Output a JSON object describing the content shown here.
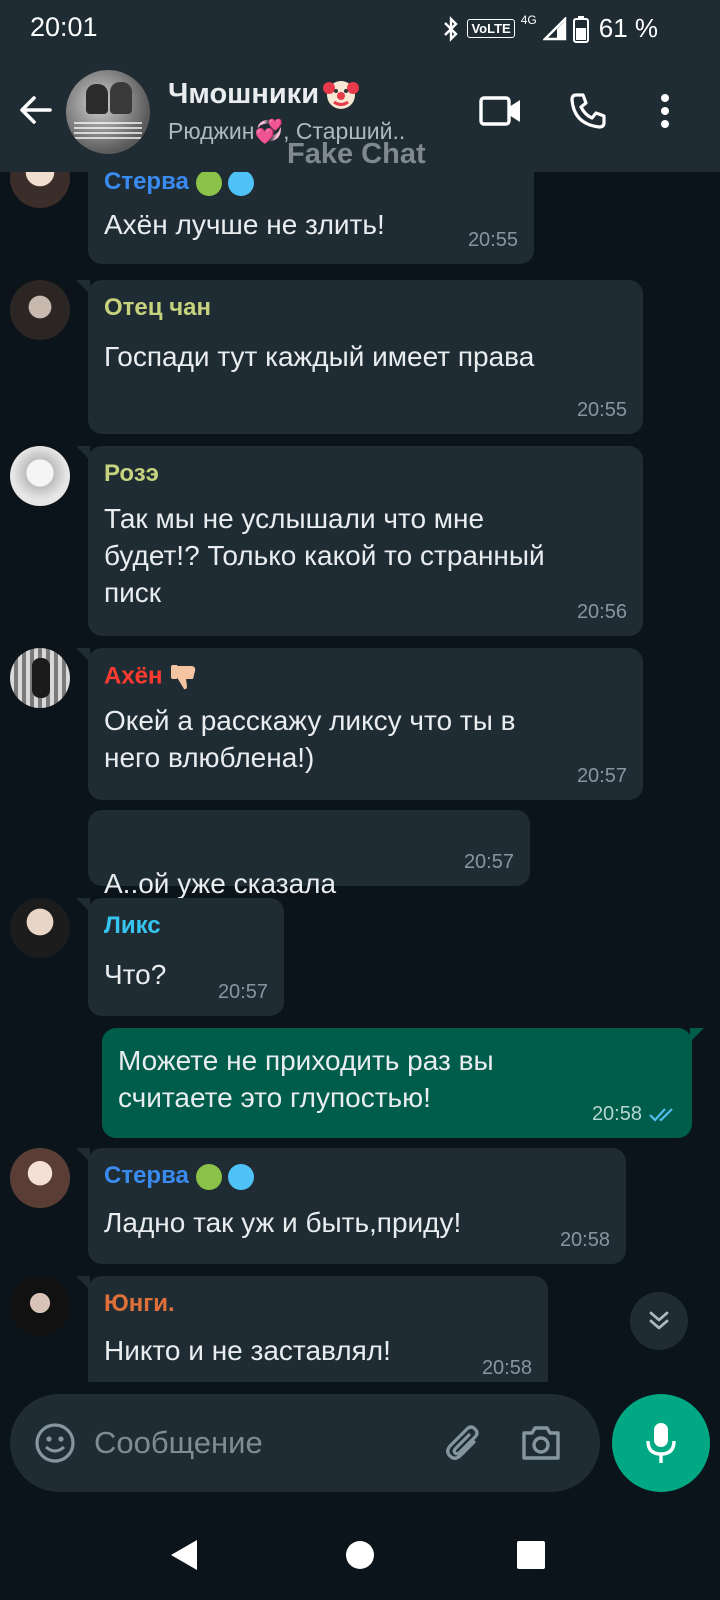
{
  "status_bar": {
    "time": "20:01",
    "volte": "VoLTE",
    "network": "4G",
    "battery": "61 %"
  },
  "header": {
    "title": "Чмошники",
    "subtitle": "Рюджин💞, Старший..",
    "watermark": "Fake Chat"
  },
  "messages": [
    {
      "sender": "Стерва",
      "sender_color": "#3a8bf0",
      "text": "Ахён лучше не злить!",
      "time": "20:55"
    },
    {
      "sender": "Отец чан",
      "sender_color": "#c6d27e",
      "text": "Госпади тут каждый имеет права",
      "time": "20:55"
    },
    {
      "sender": "Розэ",
      "sender_color": "#c6d27e",
      "text": "Так мы не услышали что мне\nбудет!? Только какой то странный\nписк",
      "time": "20:56"
    },
    {
      "sender": "Ахён",
      "sender_color": "#ff3b30",
      "text": "Окей а расскажу ликсу что ты в\nнего влюблена!)",
      "time": "20:57"
    },
    {
      "sender": "",
      "text": "А..ой уже сказала",
      "time": "20:57"
    },
    {
      "sender": "Ликс",
      "sender_color": "#35c5f0",
      "text": "Что?",
      "time": "20:57"
    },
    {
      "sender": "",
      "text": "Можете не приходить раз вы\nсчитаете это глупостью!",
      "time": "20:58",
      "outgoing": true
    },
    {
      "sender": "Стерва",
      "sender_color": "#3a8bf0",
      "text": "Ладно так уж и быть,приду!",
      "time": "20:58"
    },
    {
      "sender": "Юнги.",
      "sender_color": "#e0703a",
      "text": "Никто и не заставлял!",
      "time": "20:58"
    }
  ],
  "input": {
    "placeholder": "Сообщение"
  },
  "colors": {
    "header_bg": "#1f2c33",
    "chat_bg": "#0b141a",
    "incoming_bubble": "#202c33",
    "outgoing_bubble": "#005c4b",
    "accent": "#00a884",
    "read_ticks": "#53bdeb"
  },
  "icons": [
    "back-arrow-icon",
    "video-call-icon",
    "phone-icon",
    "more-vert-icon",
    "emoji-icon",
    "attach-icon",
    "camera-icon",
    "mic-icon",
    "scroll-down-icon",
    "nav-back-icon",
    "nav-home-icon",
    "nav-recents-icon"
  ]
}
